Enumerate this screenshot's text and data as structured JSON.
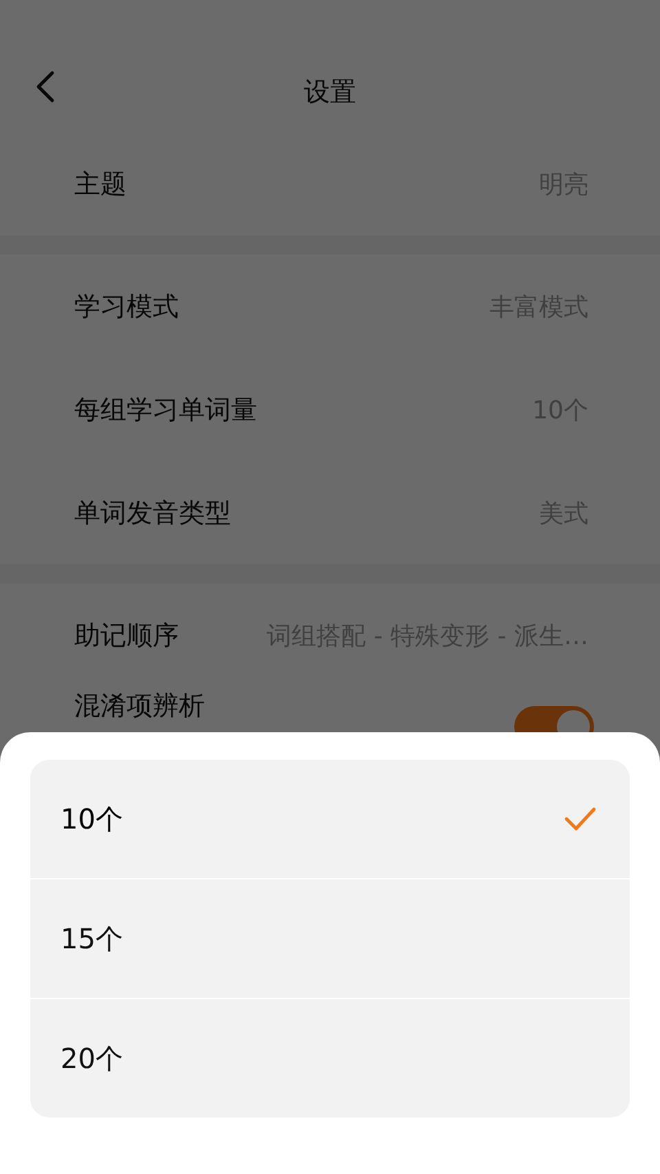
{
  "header": {
    "title": "设置"
  },
  "sections": [
    {
      "rows": [
        {
          "kind": "value",
          "label": "主题",
          "value": "明亮"
        }
      ]
    },
    {
      "rows": [
        {
          "kind": "value",
          "label": "学习模式",
          "value": "丰富模式"
        },
        {
          "kind": "value",
          "label": "每组学习单词量",
          "value": "10个"
        },
        {
          "kind": "value",
          "label": "单词发音类型",
          "value": "美式"
        }
      ]
    },
    {
      "rows": [
        {
          "kind": "value",
          "label": "助记顺序",
          "value": "词组搭配 - 特殊变形 - 派生…"
        },
        {
          "kind": "toggle",
          "label": "混淆项辨析",
          "on": true
        }
      ]
    }
  ],
  "sheet": {
    "options": [
      {
        "label": "10个",
        "selected": true
      },
      {
        "label": "15个",
        "selected": false
      },
      {
        "label": "20个",
        "selected": false
      }
    ]
  }
}
